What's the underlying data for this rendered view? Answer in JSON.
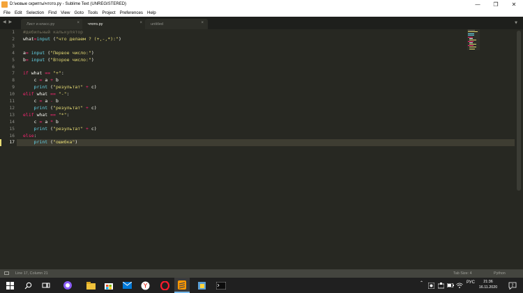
{
  "window": {
    "title": "D:\\новые скрипты\\чтото.py - Sublime Text (UNREGISTERED)",
    "minimize": "—",
    "maximize": "❐",
    "close": "✕"
  },
  "menu": [
    "File",
    "Edit",
    "Selection",
    "Find",
    "View",
    "Goto",
    "Tools",
    "Project",
    "Preferences",
    "Help"
  ],
  "tabs": [
    {
      "label": "Лист и класс.py",
      "active": false
    },
    {
      "label": "чтото.py",
      "active": true
    },
    {
      "label": "untitled",
      "active": false
    }
  ],
  "tab_close_glyph": "×",
  "tab_nav_arrows": "◀ ▶",
  "tab_dropdown": "▼",
  "editor": {
    "line_numbers": [
      "1",
      "2",
      "3",
      "4",
      "5",
      "6",
      "7",
      "8",
      "9",
      "10",
      "11",
      "12",
      "13",
      "14",
      "15",
      "16",
      "17"
    ],
    "current_line": 17
  },
  "status": {
    "position": "Line 17, Column 21",
    "tab_size": "Tab Size: 4",
    "syntax": "Python"
  },
  "taskbar": {
    "language": "РУС",
    "time": "21:36",
    "date": "16.11.2020",
    "notification_count": "2"
  },
  "colors": {
    "editor_bg": "#272822",
    "keyword": "#f92672",
    "builtin": "#66d9ef",
    "string": "#e6db74",
    "comment": "#75715e"
  }
}
